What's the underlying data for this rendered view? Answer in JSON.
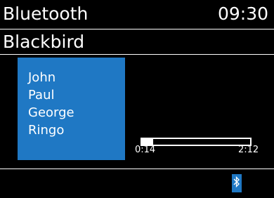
{
  "header": {
    "source": "Bluetooth",
    "clock": "09:30"
  },
  "track": {
    "title": "Blackbird"
  },
  "info_box": {
    "lines": [
      "John",
      "Paul",
      "George",
      "Ringo"
    ],
    "color": "#1f78c4"
  },
  "playback": {
    "elapsed": "0:14",
    "total": "2:12",
    "progress_fraction": 0.106
  },
  "status_bar": {
    "bluetooth_icon": "bluetooth-icon",
    "badge_color": "#1f78c4"
  }
}
